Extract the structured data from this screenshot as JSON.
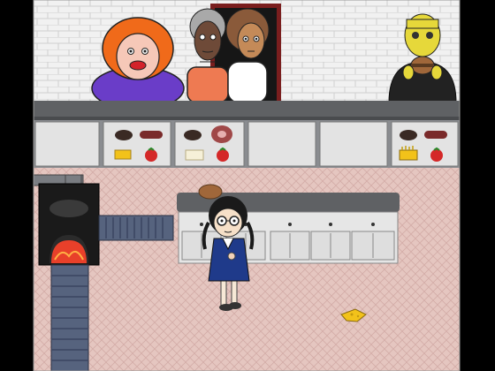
{
  "colors": {
    "wall": "#efefef",
    "brick_line": "#c9c9c9",
    "floor": "#e6c8c2",
    "floor_grid": "#d4aeaa",
    "counter_top": "#5f6164",
    "counter_panel": "#e3e3e3",
    "door_frame": "#7a1e1e",
    "oven_fire": "#e8402a",
    "conveyor": "#4b5a78"
  },
  "counter_slots": [
    {
      "name": "slot-1",
      "items": []
    },
    {
      "name": "slot-2",
      "items": [
        "bun-icon",
        "sausage-icon",
        "cheese-icon",
        "tomato-icon"
      ]
    },
    {
      "name": "slot-3",
      "items": [
        "bun-icon",
        "ham-icon",
        "bread-slice-icon",
        "tomato-icon"
      ]
    },
    {
      "name": "slot-4",
      "items": []
    },
    {
      "name": "slot-5",
      "items": []
    },
    {
      "name": "slot-6",
      "items": [
        "bun-icon",
        "sausage-icon",
        "fries-box-icon",
        "tomato-icon"
      ]
    }
  ],
  "customers": [
    {
      "name": "customer-red-hair-woman"
    },
    {
      "name": "customer-grandma"
    },
    {
      "name": "customer-brown-hair-woman"
    },
    {
      "name": "customer-bald-man-eating-burger"
    }
  ],
  "player": {
    "name": "chef-girl-with-glasses"
  },
  "floor_item": {
    "name": "dropped-cheese-icon"
  }
}
